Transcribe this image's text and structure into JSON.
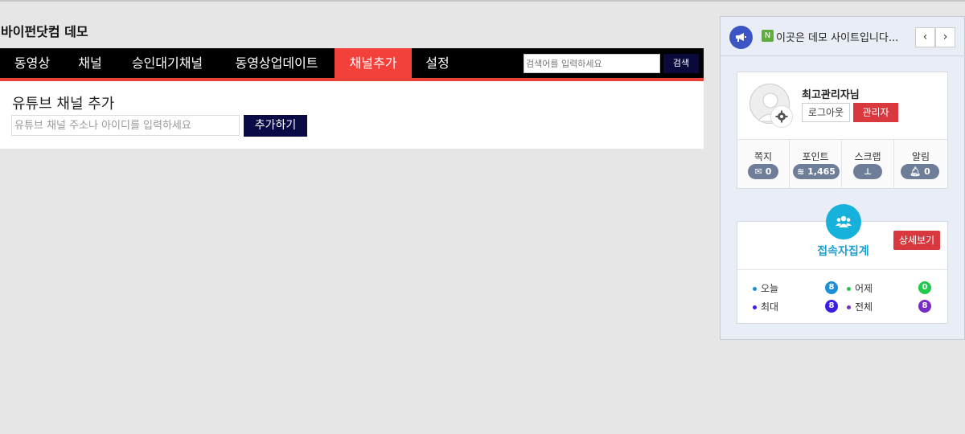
{
  "site": {
    "title": "바이펀닷컴 데모"
  },
  "nav": {
    "items": [
      {
        "label": "동영상"
      },
      {
        "label": "채널"
      },
      {
        "label": "승인대기채널"
      },
      {
        "label": "동영상업데이트"
      },
      {
        "label": "채널추가",
        "active": true
      },
      {
        "label": "설정"
      }
    ],
    "search_placeholder": "검색어를 입력하세요",
    "search_button": "검색"
  },
  "colors": {
    "accent": "#f4403a",
    "nav_bg": "#000000",
    "button_dark": "#0a0a46",
    "danger": "#d9383e",
    "info": "#16b2dc"
  },
  "main": {
    "title": "유튜브 채널 추가",
    "input_placeholder": "유튜브 채널 주소나 아이디를 입력하세요",
    "add_button": "추가하기"
  },
  "notice": {
    "icon": "megaphone-icon",
    "badge": "N",
    "text": "이곳은 데모 사이트입니다...",
    "prev": "‹",
    "next": "›"
  },
  "profile": {
    "name": "최고관리자님",
    "logout": "로그아웃",
    "admin": "관리자",
    "stats": [
      {
        "label": "쪽지",
        "icon": "envelope-icon",
        "value": "0"
      },
      {
        "label": "포인트",
        "icon": "coins-icon",
        "value": "1,465"
      },
      {
        "label": "스크랩",
        "icon": "pin-icon",
        "value": ""
      },
      {
        "label": "알림",
        "icon": "bell-icon",
        "value": "0"
      }
    ]
  },
  "visitors": {
    "title": "접속자집계",
    "detail_button": "상세보기",
    "rows": [
      {
        "label": "오늘",
        "value": "8",
        "color": "#1d8fd8"
      },
      {
        "label": "어제",
        "value": "0",
        "color": "#20c94a"
      },
      {
        "label": "최대",
        "value": "8",
        "color": "#3a1fe0"
      },
      {
        "label": "전체",
        "value": "8",
        "color": "#7a2cc9"
      }
    ]
  }
}
